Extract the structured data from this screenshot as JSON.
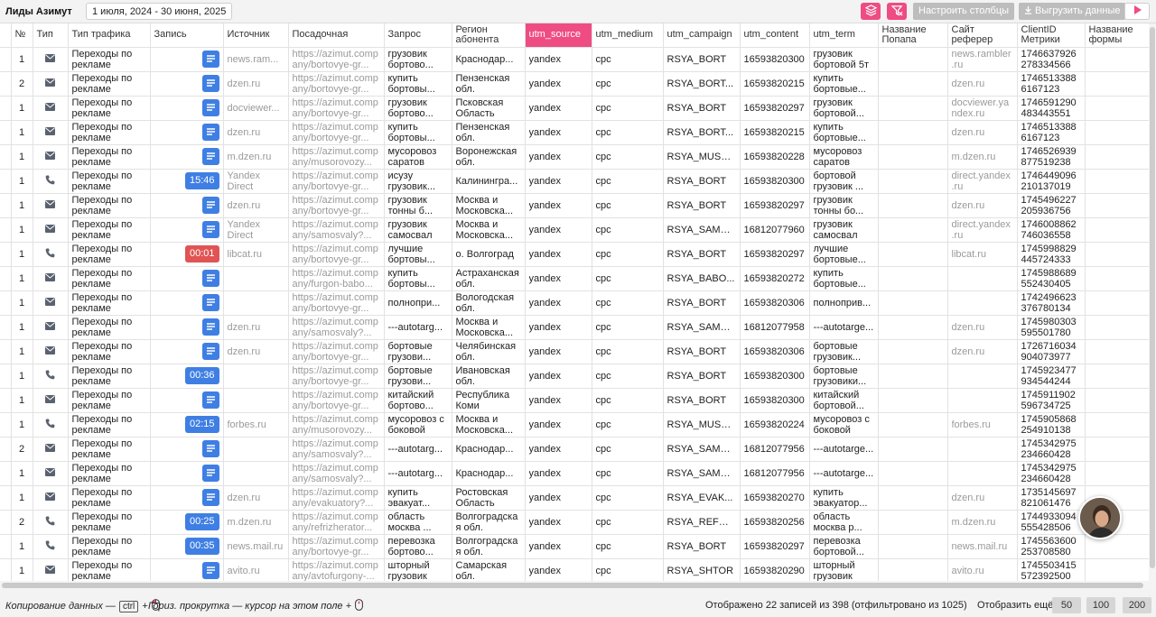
{
  "header": {
    "title": "Лиды Азимут",
    "date_range": "1 июля, 2024 - 30 июня, 2025",
    "configure_columns": "Настроить столбцы",
    "export_data": "Выгрузить данные"
  },
  "colors": {
    "accent": "#ee4c83",
    "record_doc": "#3f7fe3",
    "record_time_blue": "#3f7fe3",
    "record_time_red": "#e05454"
  },
  "table": {
    "columns": [
      "№",
      "Тип",
      "Тип трафика",
      "Запись",
      "Источник",
      "Посадочная",
      "Запрос",
      "Регион абонента",
      "utm_source",
      "utm_medium",
      "utm_campaign",
      "utm_content",
      "utm_term",
      "Название Попапа",
      "Сайт реферер",
      "ClientID Метрики",
      "Название формы"
    ],
    "rows": [
      {
        "n": "1",
        "type": "mail",
        "traffic": "Переходы по рекламе",
        "rec": {
          "kind": "doc"
        },
        "source": "news.ram...",
        "landing": "https://azimut.company/bortovye-gr...",
        "query": "грузовик бортово...",
        "region": "Краснодар...",
        "utm_source": "yandex",
        "utm_medium": "cpc",
        "utm_campaign": "RSYA_BORT",
        "utm_content": "16593820300",
        "utm_term": "грузовик бортовой 5т",
        "popup": "",
        "referer": "news.rambler.ru",
        "clientid": "1746637926278334566",
        "form": ""
      },
      {
        "n": "2",
        "type": "mail",
        "traffic": "Переходы по рекламе",
        "rec": {
          "kind": "doc"
        },
        "source": "dzen.ru",
        "landing": "https://azimut.company/bortovye-gr...",
        "query": "купить бортовы...",
        "region": "Пензенская обл.",
        "utm_source": "yandex",
        "utm_medium": "cpc",
        "utm_campaign": "RSYA_BORT...",
        "utm_content": "16593820215",
        "utm_term": "купить бортовые...",
        "popup": "",
        "referer": "dzen.ru",
        "clientid": "17465133886167123",
        "form": ""
      },
      {
        "n": "1",
        "type": "mail",
        "traffic": "Переходы по рекламе",
        "rec": {
          "kind": "doc"
        },
        "source": "docviewer...",
        "landing": "https://azimut.company/bortovye-gr...",
        "query": "грузовик бортово...",
        "region": "Псковская Область",
        "utm_source": "yandex",
        "utm_medium": "cpc",
        "utm_campaign": "RSYA_BORT",
        "utm_content": "16593820297",
        "utm_term": "грузовик бортовой...",
        "popup": "",
        "referer": "docviewer.yandex.ru",
        "clientid": "1746591290483443551",
        "form": ""
      },
      {
        "n": "1",
        "type": "mail",
        "traffic": "Переходы по рекламе",
        "rec": {
          "kind": "doc"
        },
        "source": "dzen.ru",
        "landing": "https://azimut.company/bortovye-gr...",
        "query": "купить бортовы...",
        "region": "Пензенская обл.",
        "utm_source": "yandex",
        "utm_medium": "cpc",
        "utm_campaign": "RSYA_BORT...",
        "utm_content": "16593820215",
        "utm_term": "купить бортовые...",
        "popup": "",
        "referer": "dzen.ru",
        "clientid": "17465133886167123",
        "form": ""
      },
      {
        "n": "1",
        "type": "mail",
        "traffic": "Переходы по рекламе",
        "rec": {
          "kind": "doc"
        },
        "source": "m.dzen.ru",
        "landing": "https://azimut.company/musorovozy...",
        "query": "мусоровоз саратов",
        "region": "Воронежская обл.",
        "utm_source": "yandex",
        "utm_medium": "cpc",
        "utm_campaign": "RSYA_MUSOR",
        "utm_content": "16593820228",
        "utm_term": "мусоровоз саратов",
        "popup": "",
        "referer": "m.dzen.ru",
        "clientid": "1746526939877519238",
        "form": ""
      },
      {
        "n": "1",
        "type": "phone",
        "traffic": "Переходы по рекламе",
        "rec": {
          "kind": "time",
          "label": "15:46",
          "color": "#3f7fe3"
        },
        "source": "Yandex Direct",
        "landing": "https://azimut.company/bortovye-gr...",
        "query": "исузу грузовик...",
        "region": "Калинингра...",
        "utm_source": "yandex",
        "utm_medium": "cpc",
        "utm_campaign": "RSYA_BORT",
        "utm_content": "16593820300",
        "utm_term": "бортовой грузовик ...",
        "popup": "",
        "referer": "direct.yandex.ru",
        "clientid": "1746449096210137019",
        "form": ""
      },
      {
        "n": "1",
        "type": "mail",
        "traffic": "Переходы по рекламе",
        "rec": {
          "kind": "doc"
        },
        "source": "dzen.ru",
        "landing": "https://azimut.company/bortovye-gr...",
        "query": "грузовик тонны б...",
        "region": "Москва и Московска...",
        "utm_source": "yandex",
        "utm_medium": "cpc",
        "utm_campaign": "RSYA_BORT",
        "utm_content": "16593820297",
        "utm_term": "грузовик тонны бо...",
        "popup": "",
        "referer": "dzen.ru",
        "clientid": "1745496227205936756",
        "form": ""
      },
      {
        "n": "1",
        "type": "mail",
        "traffic": "Переходы по рекламе",
        "rec": {
          "kind": "doc"
        },
        "source": "Yandex Direct",
        "landing": "https://azimut.company/samosvaly?...",
        "query": "грузовик самосвал",
        "region": "Москва и Московска...",
        "utm_source": "yandex",
        "utm_medium": "cpc",
        "utm_campaign": "RSYA_SAMO...",
        "utm_content": "16812077960",
        "utm_term": "грузовик самосвал",
        "popup": "",
        "referer": "direct.yandex.ru",
        "clientid": "1746008862746036558",
        "form": ""
      },
      {
        "n": "1",
        "type": "phone",
        "traffic": "Переходы по рекламе",
        "rec": {
          "kind": "time",
          "label": "00:01",
          "color": "#e05454"
        },
        "source": "libcat.ru",
        "landing": "https://azimut.company/bortovye-gr...",
        "query": "лучшие бортовы...",
        "region": "о. Волгоград",
        "utm_source": "yandex",
        "utm_medium": "cpc",
        "utm_campaign": "RSYA_BORT",
        "utm_content": "16593820297",
        "utm_term": "лучшие бортовые...",
        "popup": "",
        "referer": "libcat.ru",
        "clientid": "1745998829445724333",
        "form": ""
      },
      {
        "n": "1",
        "type": "mail",
        "traffic": "Переходы по рекламе",
        "rec": {
          "kind": "doc"
        },
        "source": "",
        "landing": "https://azimut.company/furgon-babo...",
        "query": "купить бортовы...",
        "region": "Астраханская обл.",
        "utm_source": "yandex",
        "utm_medium": "cpc",
        "utm_campaign": "RSYA_BABO...",
        "utm_content": "16593820272",
        "utm_term": "купить бортовые...",
        "popup": "",
        "referer": "",
        "clientid": "1745988689552430405",
        "form": ""
      },
      {
        "n": "1",
        "type": "mail",
        "traffic": "Переходы по рекламе",
        "rec": {
          "kind": "doc"
        },
        "source": "",
        "landing": "https://azimut.company/bortovye-gr...",
        "query": "полнопри...",
        "region": "Вологодская обл.",
        "utm_source": "yandex",
        "utm_medium": "cpc",
        "utm_campaign": "RSYA_BORT",
        "utm_content": "16593820306",
        "utm_term": "полноприв...",
        "popup": "",
        "referer": "",
        "clientid": "1742496623376780134",
        "form": ""
      },
      {
        "n": "1",
        "type": "mail",
        "traffic": "Переходы по рекламе",
        "rec": {
          "kind": "doc"
        },
        "source": "dzen.ru",
        "landing": "https://azimut.company/samosvaly?...",
        "query": "---autotarg...",
        "region": "Москва и Московска...",
        "utm_source": "yandex",
        "utm_medium": "cpc",
        "utm_campaign": "RSYA_SAMO...",
        "utm_content": "16812077958",
        "utm_term": "---autotarge...",
        "popup": "",
        "referer": "dzen.ru",
        "clientid": "1745980303595501780",
        "form": ""
      },
      {
        "n": "1",
        "type": "mail",
        "traffic": "Переходы по рекламе",
        "rec": {
          "kind": "doc"
        },
        "source": "dzen.ru",
        "landing": "https://azimut.company/bortovye-gr...",
        "query": "бортовые грузови...",
        "region": "Челябинская обл.",
        "utm_source": "yandex",
        "utm_medium": "cpc",
        "utm_campaign": "RSYA_BORT",
        "utm_content": "16593820306",
        "utm_term": "бортовые грузовик...",
        "popup": "",
        "referer": "dzen.ru",
        "clientid": "1726716034904073977",
        "form": ""
      },
      {
        "n": "1",
        "type": "phone",
        "traffic": "Переходы по рекламе",
        "rec": {
          "kind": "time",
          "label": "00:36",
          "color": "#3f7fe3"
        },
        "source": "",
        "landing": "https://azimut.company/bortovye-gr...",
        "query": "бортовые грузови...",
        "region": "Ивановская обл.",
        "utm_source": "yandex",
        "utm_medium": "cpc",
        "utm_campaign": "RSYA_BORT",
        "utm_content": "16593820300",
        "utm_term": "бортовые грузовики...",
        "popup": "",
        "referer": "",
        "clientid": "1745923477934544244",
        "form": ""
      },
      {
        "n": "1",
        "type": "mail",
        "traffic": "Переходы по рекламе",
        "rec": {
          "kind": "doc"
        },
        "source": "",
        "landing": "https://azimut.company/bortovye-gr...",
        "query": "китайский бортово...",
        "region": "Республика Коми",
        "utm_source": "yandex",
        "utm_medium": "cpc",
        "utm_campaign": "RSYA_BORT",
        "utm_content": "16593820300",
        "utm_term": "китайский бортовой...",
        "popup": "",
        "referer": "",
        "clientid": "1745911902596734725",
        "form": ""
      },
      {
        "n": "1",
        "type": "phone",
        "traffic": "Переходы по рекламе",
        "rec": {
          "kind": "time",
          "label": "02:15",
          "color": "#3f7fe3"
        },
        "source": "forbes.ru",
        "landing": "https://azimut.company/musorovozy...",
        "query": "мусоровоз с боковой",
        "region": "Москва и Московска...",
        "utm_source": "yandex",
        "utm_medium": "cpc",
        "utm_campaign": "RSYA_MUSOR",
        "utm_content": "16593820224",
        "utm_term": "мусоровоз с боковой",
        "popup": "",
        "referer": "forbes.ru",
        "clientid": "1745905868254910138",
        "form": ""
      },
      {
        "n": "2",
        "type": "mail",
        "traffic": "Переходы по рекламе",
        "rec": {
          "kind": "doc"
        },
        "source": "",
        "landing": "https://azimut.company/samosvaly?...",
        "query": "---autotarg...",
        "region": "Краснодар...",
        "utm_source": "yandex",
        "utm_medium": "cpc",
        "utm_campaign": "RSYA_SAMO...",
        "utm_content": "16812077956",
        "utm_term": "---autotarge...",
        "popup": "",
        "referer": "",
        "clientid": "1745342975234660428",
        "form": ""
      },
      {
        "n": "1",
        "type": "mail",
        "traffic": "Переходы по рекламе",
        "rec": {
          "kind": "doc"
        },
        "source": "",
        "landing": "https://azimut.company/samosvaly?...",
        "query": "---autotarg...",
        "region": "Краснодар...",
        "utm_source": "yandex",
        "utm_medium": "cpc",
        "utm_campaign": "RSYA_SAMO...",
        "utm_content": "16812077956",
        "utm_term": "---autotarge...",
        "popup": "",
        "referer": "",
        "clientid": "1745342975234660428",
        "form": ""
      },
      {
        "n": "1",
        "type": "mail",
        "traffic": "Переходы по рекламе",
        "rec": {
          "kind": "doc"
        },
        "source": "dzen.ru",
        "landing": "https://azimut.company/evakuatory?...",
        "query": "купить эвакуат...",
        "region": "Ростовская Область",
        "utm_source": "yandex",
        "utm_medium": "cpc",
        "utm_campaign": "RSYA_EVAK...",
        "utm_content": "16593820270",
        "utm_term": "купить эвакуатор...",
        "popup": "",
        "referer": "dzen.ru",
        "clientid": "1735145697821061476",
        "form": ""
      },
      {
        "n": "2",
        "type": "phone",
        "traffic": "Переходы по рекламе",
        "rec": {
          "kind": "time",
          "label": "00:25",
          "color": "#3f7fe3"
        },
        "source": "m.dzen.ru",
        "landing": "https://azimut.company/refrizherator...",
        "query": "область москва ...",
        "region": "Волгоградская обл.",
        "utm_source": "yandex",
        "utm_medium": "cpc",
        "utm_campaign": "RSYA_REFRI...",
        "utm_content": "16593820256",
        "utm_term": "область москва р...",
        "popup": "",
        "referer": "m.dzen.ru",
        "clientid": "1744933094555428506",
        "form": ""
      },
      {
        "n": "1",
        "type": "phone",
        "traffic": "Переходы по рекламе",
        "rec": {
          "kind": "time",
          "label": "00:35",
          "color": "#3f7fe3"
        },
        "source": "news.mail.ru",
        "landing": "https://azimut.company/bortovye-gr...",
        "query": "перевозка бортово...",
        "region": "Волгоградская обл.",
        "utm_source": "yandex",
        "utm_medium": "cpc",
        "utm_campaign": "RSYA_BORT",
        "utm_content": "16593820297",
        "utm_term": "перевозка бортовой...",
        "popup": "",
        "referer": "news.mail.ru",
        "clientid": "1745563600253708580",
        "form": ""
      },
      {
        "n": "1",
        "type": "mail",
        "traffic": "Переходы по рекламе",
        "rec": {
          "kind": "doc"
        },
        "source": "avito.ru",
        "landing": "https://azimut.company/avtofurgony-...",
        "query": "шторный грузовик",
        "region": "Самарская обл.",
        "utm_source": "yandex",
        "utm_medium": "cpc",
        "utm_campaign": "RSYA_SHTOR",
        "utm_content": "16593820290",
        "utm_term": "шторный грузовик",
        "popup": "",
        "referer": "avito.ru",
        "clientid": "1745503415572392500",
        "form": ""
      }
    ]
  },
  "footer": {
    "copy_hint_a": "Копирование данных —",
    "copy_key": "ctrl",
    "plus": "+",
    "scroll_hint": "Гориз. прокрутка — курсор на этом поле +",
    "records_info": "Отображено 22 записей из 398 (отфильтровано из 1025)",
    "show_more_label": "Отобразить ещё:",
    "page_sizes": [
      "50",
      "100",
      "200"
    ]
  }
}
